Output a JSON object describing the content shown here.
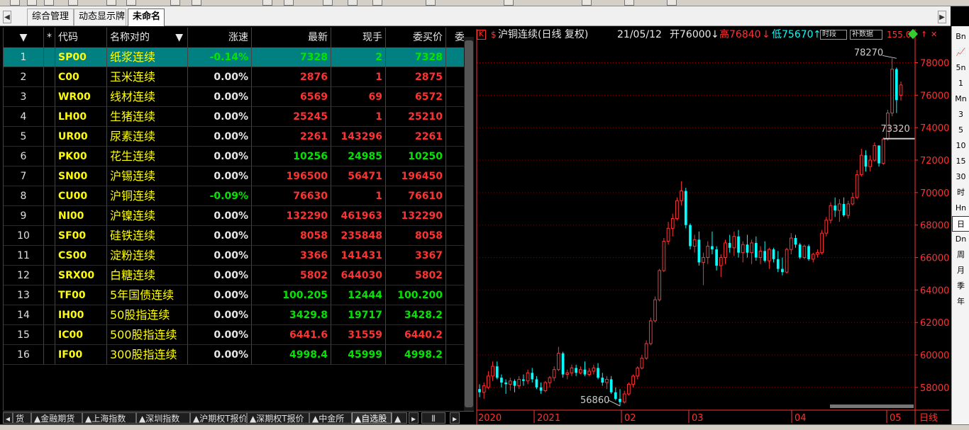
{
  "tabs": [
    {
      "label": "综合管理"
    },
    {
      "label": "动态显示牌"
    },
    {
      "label": "未命名"
    }
  ],
  "tab_nav": {
    "left_arrow": "◀",
    "right_arrow": "▶"
  },
  "table": {
    "headers": {
      "sort": "▼",
      "star": "*",
      "code": "代码",
      "name": "名称对的",
      "name_sort": "▼",
      "change": "涨速",
      "last": "最新",
      "hand": "现手",
      "bid": "委买价",
      "more": "委"
    },
    "rows": [
      {
        "num": "1",
        "code": "SP00",
        "name": "纸浆连续",
        "change": "-0.14%",
        "last": "7328",
        "hand": "2",
        "bid": "7328",
        "chg_dir": "down",
        "last_dir": "down",
        "hand_dir": "down",
        "bid_dir": "down"
      },
      {
        "num": "2",
        "code": "C00",
        "name": "玉米连续",
        "change": "0.00%",
        "last": "2876",
        "hand": "1",
        "bid": "2875",
        "chg_dir": "flat",
        "last_dir": "up",
        "hand_dir": "up",
        "bid_dir": "up"
      },
      {
        "num": "3",
        "code": "WR00",
        "name": "线材连续",
        "change": "0.00%",
        "last": "6569",
        "hand": "69",
        "bid": "6572",
        "chg_dir": "flat",
        "last_dir": "up",
        "hand_dir": "up",
        "bid_dir": "up"
      },
      {
        "num": "4",
        "code": "LH00",
        "name": "生猪连续",
        "change": "0.00%",
        "last": "25245",
        "hand": "1",
        "bid": "25210",
        "chg_dir": "flat",
        "last_dir": "up",
        "hand_dir": "up",
        "bid_dir": "up"
      },
      {
        "num": "5",
        "code": "UR00",
        "name": "尿素连续",
        "change": "0.00%",
        "last": "2261",
        "hand": "143296",
        "bid": "2261",
        "chg_dir": "flat",
        "last_dir": "up",
        "hand_dir": "up",
        "bid_dir": "up"
      },
      {
        "num": "6",
        "code": "PK00",
        "name": "花生连续",
        "change": "0.00%",
        "last": "10256",
        "hand": "24985",
        "bid": "10250",
        "chg_dir": "flat",
        "last_dir": "down",
        "hand_dir": "down",
        "bid_dir": "down"
      },
      {
        "num": "7",
        "code": "SN00",
        "name": "沪锡连续",
        "change": "0.00%",
        "last": "196500",
        "hand": "56471",
        "bid": "196450",
        "chg_dir": "flat",
        "last_dir": "up",
        "hand_dir": "up",
        "bid_dir": "up"
      },
      {
        "num": "8",
        "code": "CU00",
        "name": "沪铜连续",
        "change": "-0.09%",
        "last": "76630",
        "hand": "1",
        "bid": "76610",
        "chg_dir": "down",
        "last_dir": "up",
        "hand_dir": "up",
        "bid_dir": "up"
      },
      {
        "num": "9",
        "code": "NI00",
        "name": "沪镍连续",
        "change": "0.00%",
        "last": "132290",
        "hand": "461963",
        "bid": "132290",
        "chg_dir": "flat",
        "last_dir": "up",
        "hand_dir": "up",
        "bid_dir": "up"
      },
      {
        "num": "10",
        "code": "SF00",
        "name": "硅铁连续",
        "change": "0.00%",
        "last": "8058",
        "hand": "235848",
        "bid": "8058",
        "chg_dir": "flat",
        "last_dir": "up",
        "hand_dir": "up",
        "bid_dir": "up"
      },
      {
        "num": "11",
        "code": "CS00",
        "name": "淀粉连续",
        "change": "0.00%",
        "last": "3366",
        "hand": "141431",
        "bid": "3367",
        "chg_dir": "flat",
        "last_dir": "up",
        "hand_dir": "up",
        "bid_dir": "up"
      },
      {
        "num": "12",
        "code": "SRX00",
        "name": "白糖连续",
        "change": "0.00%",
        "last": "5802",
        "hand": "644030",
        "bid": "5802",
        "chg_dir": "flat",
        "last_dir": "up",
        "hand_dir": "up",
        "bid_dir": "up"
      },
      {
        "num": "13",
        "code": "TF00",
        "name": "5年国债连续",
        "change": "0.00%",
        "last": "100.205",
        "hand": "12444",
        "bid": "100.200",
        "chg_dir": "flat",
        "last_dir": "down",
        "hand_dir": "down",
        "bid_dir": "down"
      },
      {
        "num": "14",
        "code": "IH00",
        "name": "50股指连续",
        "change": "0.00%",
        "last": "3429.8",
        "hand": "19717",
        "bid": "3428.2",
        "chg_dir": "flat",
        "last_dir": "down",
        "hand_dir": "down",
        "bid_dir": "down"
      },
      {
        "num": "15",
        "code": "IC00",
        "name": "500股指连续",
        "change": "0.00%",
        "last": "6441.6",
        "hand": "31559",
        "bid": "6440.2",
        "chg_dir": "flat",
        "last_dir": "up",
        "hand_dir": "up",
        "bid_dir": "up"
      },
      {
        "num": "16",
        "code": "IF00",
        "name": "300股指连续",
        "change": "0.00%",
        "last": "4998.4",
        "hand": "45999",
        "bid": "4998.2",
        "chg_dir": "flat",
        "last_dir": "down",
        "hand_dir": "down",
        "bid_dir": "down"
      }
    ]
  },
  "sheet_tabs": [
    {
      "label": "货"
    },
    {
      "label": "▲金融期货"
    },
    {
      "label": "▲上海指数"
    },
    {
      "label": "▲深圳指数"
    },
    {
      "label": "▲沪期权T报价"
    },
    {
      "label": "▲深期权T报价"
    },
    {
      "label": "▲中金所"
    },
    {
      "label": "▲自选股"
    },
    {
      "label": "▲"
    }
  ],
  "chart_header": {
    "k_label": "K",
    "dollar": "$",
    "title": "沪铜连续(日线 复权)",
    "date": "21/05/12",
    "open_label": "开",
    "open": "76000",
    "open_arrow": "↓",
    "high_label": "高",
    "high": "76840",
    "high_arrow": "↓",
    "low_label": "低",
    "low": "75670",
    "low_arrow": "↑",
    "time_seg": "时段",
    "fill_data": "补数据",
    "extra": "155.0"
  },
  "period_bar": [
    {
      "label": "Bn"
    },
    {
      "label": "📈"
    },
    {
      "label": "5n"
    },
    {
      "label": "1"
    },
    {
      "label": "Mn"
    },
    {
      "label": "3"
    },
    {
      "label": "5"
    },
    {
      "label": "10"
    },
    {
      "label": "15"
    },
    {
      "label": "30"
    },
    {
      "label": "时"
    },
    {
      "label": "Hn"
    },
    {
      "label": "日"
    },
    {
      "label": "Dn"
    },
    {
      "label": "周"
    },
    {
      "label": "月"
    },
    {
      "label": "季"
    },
    {
      "label": "年"
    }
  ],
  "chart_data": {
    "type": "candlestick",
    "title": "沪铜连续(日线 复权)",
    "y_ticks": [
      58000,
      60000,
      62000,
      64000,
      66000,
      68000,
      70000,
      72000,
      74000,
      76000,
      78000
    ],
    "ylim": [
      56600,
      79200
    ],
    "x_labels": [
      "2020",
      "2021",
      "02",
      "03",
      "04",
      "05",
      "日线"
    ],
    "annotations": [
      {
        "text": "78270",
        "value": 78270
      },
      {
        "text": "73320",
        "value": 73320
      },
      {
        "text": "56860",
        "value": 56860
      }
    ],
    "colors": {
      "up": "#ff3232",
      "down": "#00ffff",
      "axis": "#ff3232",
      "grid": "#8b0000",
      "label": "#cccccc"
    },
    "candles": [
      {
        "o": 57900,
        "h": 58200,
        "l": 57400,
        "c": 57700
      },
      {
        "o": 57700,
        "h": 58300,
        "l": 57300,
        "c": 58100
      },
      {
        "o": 58000,
        "h": 59000,
        "l": 57900,
        "c": 58700
      },
      {
        "o": 58700,
        "h": 59600,
        "l": 58400,
        "c": 59300
      },
      {
        "o": 59300,
        "h": 59600,
        "l": 58500,
        "c": 58600
      },
      {
        "o": 58600,
        "h": 58800,
        "l": 58000,
        "c": 58300
      },
      {
        "o": 58300,
        "h": 58500,
        "l": 57600,
        "c": 58200
      },
      {
        "o": 58200,
        "h": 58600,
        "l": 57800,
        "c": 58400
      },
      {
        "o": 58400,
        "h": 58500,
        "l": 57700,
        "c": 58100
      },
      {
        "o": 58100,
        "h": 58700,
        "l": 57900,
        "c": 58500
      },
      {
        "o": 58500,
        "h": 58800,
        "l": 58100,
        "c": 58400
      },
      {
        "o": 58400,
        "h": 59100,
        "l": 58200,
        "c": 58900
      },
      {
        "o": 58900,
        "h": 59200,
        "l": 58300,
        "c": 58500
      },
      {
        "o": 58500,
        "h": 58700,
        "l": 57900,
        "c": 58000
      },
      {
        "o": 58000,
        "h": 58300,
        "l": 57600,
        "c": 57800
      },
      {
        "o": 57800,
        "h": 58400,
        "l": 57700,
        "c": 58300
      },
      {
        "o": 58300,
        "h": 58700,
        "l": 58000,
        "c": 58600
      },
      {
        "o": 58600,
        "h": 59300,
        "l": 58400,
        "c": 59100
      },
      {
        "o": 59100,
        "h": 60500,
        "l": 59000,
        "c": 60100
      },
      {
        "o": 60100,
        "h": 60200,
        "l": 58600,
        "c": 58800
      },
      {
        "o": 58800,
        "h": 59100,
        "l": 58500,
        "c": 58900
      },
      {
        "o": 58900,
        "h": 59400,
        "l": 58700,
        "c": 59200
      },
      {
        "o": 59200,
        "h": 59400,
        "l": 58700,
        "c": 58900
      },
      {
        "o": 58900,
        "h": 59300,
        "l": 58800,
        "c": 59100
      },
      {
        "o": 59100,
        "h": 59600,
        "l": 58700,
        "c": 58800
      },
      {
        "o": 58800,
        "h": 59200,
        "l": 58700,
        "c": 59000
      },
      {
        "o": 59000,
        "h": 59400,
        "l": 58800,
        "c": 59200
      },
      {
        "o": 59200,
        "h": 59500,
        "l": 58500,
        "c": 58600
      },
      {
        "o": 58600,
        "h": 58900,
        "l": 58100,
        "c": 58300
      },
      {
        "o": 58300,
        "h": 58700,
        "l": 57900,
        "c": 58500
      },
      {
        "o": 58500,
        "h": 58700,
        "l": 57600,
        "c": 57700
      },
      {
        "o": 57700,
        "h": 58000,
        "l": 57200,
        "c": 57300
      },
      {
        "o": 57300,
        "h": 57900,
        "l": 56860,
        "c": 57100
      },
      {
        "o": 57100,
        "h": 57800,
        "l": 57000,
        "c": 57600
      },
      {
        "o": 57600,
        "h": 58300,
        "l": 57500,
        "c": 58200
      },
      {
        "o": 58200,
        "h": 58800,
        "l": 58000,
        "c": 58700
      },
      {
        "o": 58700,
        "h": 59300,
        "l": 58500,
        "c": 59200
      },
      {
        "o": 59200,
        "h": 60000,
        "l": 59100,
        "c": 59800
      },
      {
        "o": 59800,
        "h": 60900,
        "l": 59700,
        "c": 60700
      },
      {
        "o": 60700,
        "h": 62300,
        "l": 60600,
        "c": 62100
      },
      {
        "o": 62100,
        "h": 63600,
        "l": 62000,
        "c": 63400
      },
      {
        "o": 63400,
        "h": 65300,
        "l": 63300,
        "c": 65200
      },
      {
        "o": 65200,
        "h": 67200,
        "l": 65100,
        "c": 67000
      },
      {
        "o": 67000,
        "h": 68200,
        "l": 66800,
        "c": 67800
      },
      {
        "o": 67800,
        "h": 68700,
        "l": 67300,
        "c": 68400
      },
      {
        "o": 68400,
        "h": 69700,
        "l": 68300,
        "c": 69500
      },
      {
        "o": 69500,
        "h": 70700,
        "l": 69200,
        "c": 70100
      },
      {
        "o": 70100,
        "h": 70300,
        "l": 67800,
        "c": 68000
      },
      {
        "o": 68000,
        "h": 68100,
        "l": 66500,
        "c": 66700
      },
      {
        "o": 66700,
        "h": 67400,
        "l": 66300,
        "c": 67100
      },
      {
        "o": 67100,
        "h": 67600,
        "l": 65500,
        "c": 65700
      },
      {
        "o": 65700,
        "h": 66300,
        "l": 64300,
        "c": 66000
      },
      {
        "o": 66000,
        "h": 67000,
        "l": 65600,
        "c": 66700
      },
      {
        "o": 66700,
        "h": 67600,
        "l": 66200,
        "c": 66500
      },
      {
        "o": 66500,
        "h": 66700,
        "l": 65200,
        "c": 65500
      },
      {
        "o": 65500,
        "h": 66200,
        "l": 64800,
        "c": 66000
      },
      {
        "o": 66000,
        "h": 67100,
        "l": 65600,
        "c": 66900
      },
      {
        "o": 66900,
        "h": 67400,
        "l": 66300,
        "c": 66600
      },
      {
        "o": 66600,
        "h": 67600,
        "l": 66100,
        "c": 67300
      },
      {
        "o": 67300,
        "h": 67700,
        "l": 66000,
        "c": 66300
      },
      {
        "o": 66300,
        "h": 67000,
        "l": 65700,
        "c": 66800
      },
      {
        "o": 66800,
        "h": 67400,
        "l": 66000,
        "c": 66300
      },
      {
        "o": 66300,
        "h": 67100,
        "l": 65600,
        "c": 66900
      },
      {
        "o": 66900,
        "h": 67300,
        "l": 65800,
        "c": 66000
      },
      {
        "o": 66000,
        "h": 66700,
        "l": 65600,
        "c": 66400
      },
      {
        "o": 66400,
        "h": 67000,
        "l": 65700,
        "c": 65800
      },
      {
        "o": 65800,
        "h": 66600,
        "l": 65300,
        "c": 66500
      },
      {
        "o": 66500,
        "h": 66600,
        "l": 65700,
        "c": 65900
      },
      {
        "o": 65900,
        "h": 66400,
        "l": 65100,
        "c": 65300
      },
      {
        "o": 65300,
        "h": 66000,
        "l": 64900,
        "c": 65100
      },
      {
        "o": 65100,
        "h": 66600,
        "l": 65000,
        "c": 66500
      },
      {
        "o": 66500,
        "h": 67500,
        "l": 66200,
        "c": 67200
      },
      {
        "o": 67200,
        "h": 67400,
        "l": 66600,
        "c": 66800
      },
      {
        "o": 66800,
        "h": 66900,
        "l": 65900,
        "c": 66000
      },
      {
        "o": 66000,
        "h": 66800,
        "l": 65900,
        "c": 66700
      },
      {
        "o": 66700,
        "h": 66800,
        "l": 65800,
        "c": 65900
      },
      {
        "o": 65900,
        "h": 66300,
        "l": 65700,
        "c": 66200
      },
      {
        "o": 66200,
        "h": 66500,
        "l": 66000,
        "c": 66300
      },
      {
        "o": 66300,
        "h": 67700,
        "l": 66200,
        "c": 67500
      },
      {
        "o": 67500,
        "h": 68500,
        "l": 67300,
        "c": 68300
      },
      {
        "o": 68300,
        "h": 69400,
        "l": 68100,
        "c": 69200
      },
      {
        "o": 69200,
        "h": 69700,
        "l": 68500,
        "c": 68900
      },
      {
        "o": 68900,
        "h": 69600,
        "l": 68200,
        "c": 69300
      },
      {
        "o": 69300,
        "h": 69700,
        "l": 68500,
        "c": 68600
      },
      {
        "o": 68600,
        "h": 69500,
        "l": 68400,
        "c": 69300
      },
      {
        "o": 69300,
        "h": 70000,
        "l": 69200,
        "c": 69700
      },
      {
        "o": 69700,
        "h": 71400,
        "l": 69600,
        "c": 71100
      },
      {
        "o": 71100,
        "h": 72700,
        "l": 71000,
        "c": 72300
      },
      {
        "o": 72300,
        "h": 72600,
        "l": 71300,
        "c": 71600
      },
      {
        "o": 71600,
        "h": 72300,
        "l": 71300,
        "c": 72000
      },
      {
        "o": 72000,
        "h": 73100,
        "l": 71900,
        "c": 72900
      },
      {
        "o": 72900,
        "h": 72900,
        "l": 71600,
        "c": 71800
      },
      {
        "o": 71800,
        "h": 73400,
        "l": 71700,
        "c": 73300
      },
      {
        "o": 73300,
        "h": 75100,
        "l": 73200,
        "c": 74900
      },
      {
        "o": 74900,
        "h": 78270,
        "l": 74700,
        "c": 77600
      },
      {
        "o": 77600,
        "h": 77700,
        "l": 74900,
        "c": 75700
      },
      {
        "o": 76000,
        "h": 76840,
        "l": 75670,
        "c": 76630
      }
    ]
  }
}
